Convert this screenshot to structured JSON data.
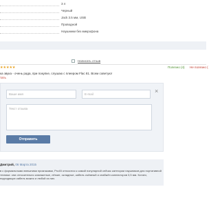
{
  "specs": [
    "3 л",
    "Черный",
    "Jack 3.5 мм, USB",
    "Проводной",
    "Наушники без микрофона"
  ],
  "write_review": {
    "label": "Написать отзыв"
  },
  "review": {
    "stars": "★★★★★",
    "useful_yes": "Полезно (4)",
    "useful_no": "Не полезно (",
    "text": "ка звука - очень рада, при покупке, слушаю с плеером Flac 81. Всем советую!",
    "link": "тать"
  },
  "form": {
    "name_placeholder": "Ваше имя",
    "email_placeholder": "E-mail",
    "text_placeholder": "Текст отзыва",
    "submit_label": "Отправить",
    "close_glyph": "×"
  },
  "review2": {
    "author": "Дмитрий,",
    "date": "06 Марта 2015",
    "text": "в с формальными внешними признаками, Pro45 относится к самой популярной сейчас категории наушников для портативной техники: они относительно компактные, лёгкие, складные, кабель съёмный и снабжён коннекторов 3,5 мм. Кстати, подходящих кабель можно и любой из них."
  }
}
